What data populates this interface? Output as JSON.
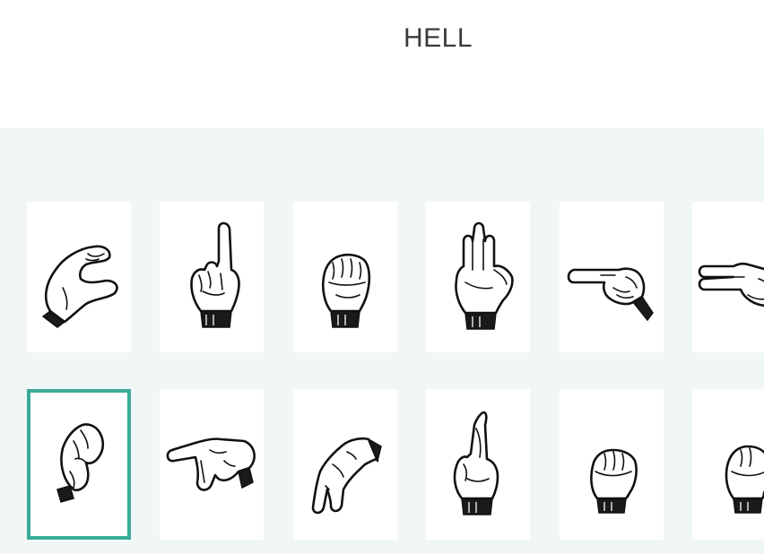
{
  "word": {
    "text": "HELL"
  },
  "grid": {
    "rows": [
      [
        {
          "icon": "asl-letter-c-hand-icon"
        },
        {
          "icon": "asl-letter-d-hand-icon"
        },
        {
          "icon": "asl-letter-e-hand-icon"
        },
        {
          "icon": "asl-letter-f-hand-icon"
        },
        {
          "icon": "asl-letter-g-hand-icon"
        },
        {
          "icon": "asl-letter-h-hand-icon"
        }
      ],
      [
        {
          "icon": "asl-letter-o-hand-icon",
          "selected": true
        },
        {
          "icon": "asl-letter-p-hand-icon"
        },
        {
          "icon": "asl-letter-q-hand-icon"
        },
        {
          "icon": "asl-letter-r-hand-icon"
        },
        {
          "icon": "asl-letter-s-hand-icon"
        },
        {
          "icon": "asl-letter-t-hand-icon"
        }
      ]
    ],
    "selected_color": "#3bab99",
    "panel_background": "#f1f7f7"
  }
}
